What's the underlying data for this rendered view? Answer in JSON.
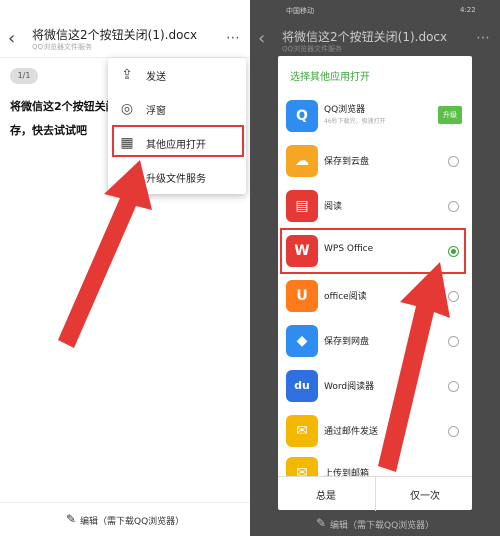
{
  "left": {
    "title": "将微信这2个按钮关闭(1).docx",
    "subtitle": "QQ浏览器文件服务",
    "page_badge": "1/1",
    "doc_line1": "将微信这2个按钮关闭",
    "doc_line2": "存，快去试试吧",
    "menu": [
      {
        "label": "发送",
        "icon": "share-icon"
      },
      {
        "label": "浮窗",
        "icon": "float-window-icon"
      },
      {
        "label": "其他应用打开",
        "icon": "apps-icon"
      },
      {
        "label": "升级文件服务",
        "icon": "upgrade-icon"
      }
    ],
    "bottom_label": "编辑（需下载QQ浏览器）"
  },
  "right": {
    "status_carrier": "中国移动",
    "status_time": "4:22",
    "title": "将微信这2个按钮关闭(1).docx",
    "subtitle": "QQ浏览器文件服务",
    "sheet_title": "选择其他应用打开",
    "apps": [
      {
        "name": "QQ浏览器",
        "desc": "46秒下载完，极速打开",
        "color": "#2f8cf0",
        "glyph": "Q",
        "action": "升级"
      },
      {
        "name": "保存到云盘",
        "color": "#f5a623",
        "glyph": "☁"
      },
      {
        "name": "阅读",
        "color": "#e53935",
        "glyph": "▤"
      },
      {
        "name": "WPS Office",
        "color": "#e53935",
        "glyph": "W",
        "selected": true
      },
      {
        "name": "office阅读",
        "color": "#ff7a1a",
        "glyph": "U"
      },
      {
        "name": "保存到网盘",
        "color": "#2f8cf0",
        "glyph": "◆"
      },
      {
        "name": "Word阅读器",
        "color": "#2f6fe0",
        "glyph": "du"
      },
      {
        "name": "通过邮件发送",
        "color": "#f5b800",
        "glyph": "✉"
      },
      {
        "name": "上传到邮箱",
        "color": "#f5b800",
        "glyph": "✉"
      }
    ],
    "btn_always": "总是",
    "btn_once": "仅一次",
    "bottom_label": "编辑（需下载QQ浏览器）"
  }
}
